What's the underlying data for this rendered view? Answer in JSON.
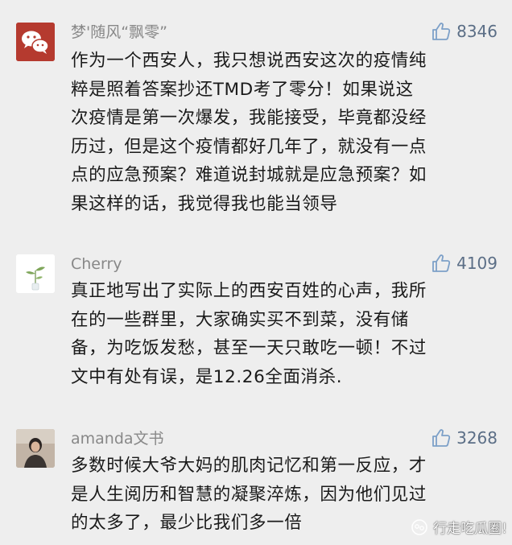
{
  "comments": [
    {
      "nickname": "梦'随风“飘零”",
      "likes": "8346",
      "avatar_icon": "wechat-logo-icon",
      "lines": [
        "作为一个西安人，我只想说西安这次的疫情纯",
        "粹是照着答案抄还TMD考了零分！如果说这",
        "次疫情是第一次爆发，我能接受，毕竟都没经",
        "历过，但是这个疫情都好几年了，就没有一点",
        "点的应急预案？难道说封城就是应急预案？如",
        "果这样的话，我觉得我也能当领导"
      ]
    },
    {
      "nickname": "Cherry",
      "likes": "4109",
      "avatar_icon": "plant-vase-icon",
      "lines": [
        "真正地写出了实际上的西安百姓的心声，我所",
        "在的一些群里，大家确实买不到菜，没有储",
        "备，为吃饭发愁，甚至一天只敢吃一顿！不过",
        "文中有处有误，是12.26全面消杀."
      ]
    },
    {
      "nickname": "amanda文书",
      "likes": "3268",
      "avatar_icon": "person-photo-icon",
      "lines": [
        "多数时候大爷大妈的肌肉记忆和第一反应，才",
        "是人生阅历和智慧的凝聚淬炼，因为他们见过",
        "的太多了，最少比我们多一倍"
      ]
    }
  ],
  "watermark": {
    "text": "行走吃瓜圈!",
    "icon": "wechat-official-account-icon"
  },
  "colors": {
    "background": "#eeeeee",
    "nickname": "#888888",
    "like_icon": "#7da0c8",
    "text": "#1a1a1a",
    "wechat_red": "#b53a2f"
  }
}
